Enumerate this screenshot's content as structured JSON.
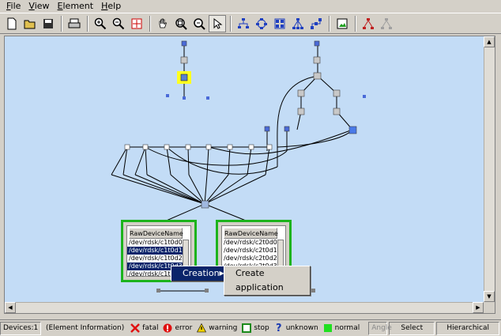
{
  "menu": {
    "items": [
      "File",
      "View",
      "Element",
      "Help"
    ]
  },
  "toolbar": {
    "buttons": [
      "new-icon",
      "open-icon",
      "save-icon",
      "print-icon",
      "zoom-in-icon",
      "zoom-out-icon",
      "fit-icon",
      "pan-hand-icon",
      "zoom-region-icon",
      "zoom-box-icon",
      "select-arrow-icon",
      "tree-layout-icon",
      "circular-layout-icon",
      "grid-layout-icon",
      "hierarchy-layout-icon",
      "orthogonal-layout-icon",
      "image-icon",
      "expand-icon",
      "collapse-icon"
    ]
  },
  "panels": {
    "left": {
      "header": "RawDeviceName",
      "rows": [
        "/dev/rdsk/c1t0d0",
        "/dev/rdsk/c1t0d1",
        "/dev/rdsk/c1t0d2",
        "/dev/rdsk/c1t0d3",
        "/dev/rdsk/c1t0d"
      ],
      "selected": [
        1,
        3
      ]
    },
    "right": {
      "header": "RawDeviceName",
      "rows": [
        "/dev/rdsk/c2t0d0",
        "/dev/rdsk/c2t0d1",
        "/dev/rdsk/c2t0d2",
        "/dev/rdsk/c2t0d3"
      ],
      "selected": []
    }
  },
  "context_menu": {
    "creation": "Creation",
    "submenu_item": "Create application"
  },
  "status": {
    "devices": "Devices:1",
    "element_info": "(Element Information)",
    "legend": [
      {
        "label": "fatal",
        "icon": "fatal-x-icon",
        "color": "#e01010"
      },
      {
        "label": "error",
        "icon": "error-circle-icon",
        "color": "#e01010"
      },
      {
        "label": "warning",
        "icon": "warning-triangle-icon",
        "color": "#f0d000"
      },
      {
        "label": "stop",
        "icon": "stop-square-icon",
        "color": "#1a8a1a"
      },
      {
        "label": "unknown",
        "icon": "unknown-question-icon",
        "color": "#1a3ab0"
      },
      {
        "label": "normal",
        "icon": "normal-square-icon",
        "color": "#20e020"
      }
    ],
    "angle": "Angle",
    "mode": "Select",
    "layout": "Hierarchical"
  },
  "colors": {
    "canvas": "#c3dcf6",
    "panel_border": "#1db31d",
    "selection": "#0a246a"
  }
}
